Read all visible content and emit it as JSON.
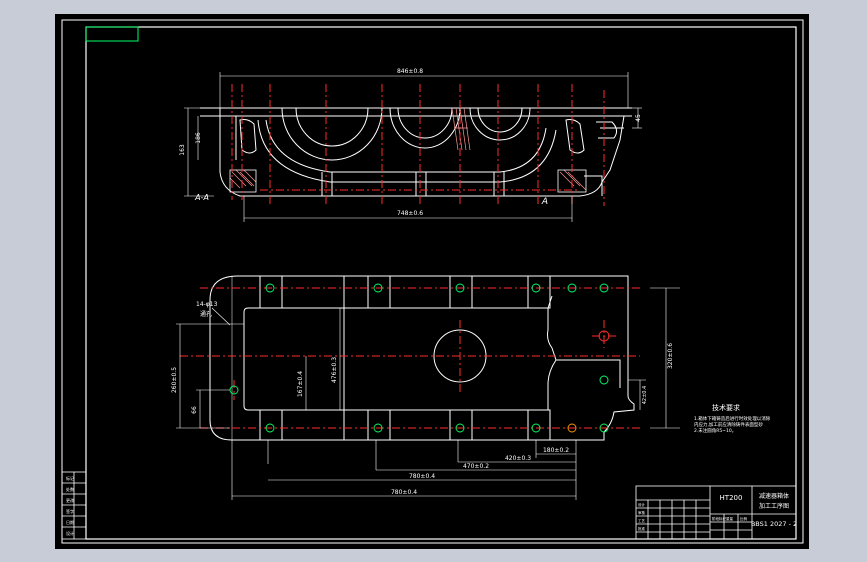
{
  "drawing": {
    "material": "HT200",
    "part_name": "减速器箱体",
    "part_sub": "加工工序图",
    "drawing_no": "BBS1 2027 - 2",
    "label_a_left": "A-A",
    "label_a_right": "A",
    "tech_title": "技术要求",
    "tech_notes": [
      "1.箱体下箱铸造后进行时效处理以消除",
      "  内应力,加工前应清除铸件表面型砂",
      "2.未注圆角R5~10。"
    ],
    "dimensions": {
      "top_length": "846±0.8",
      "top_bottom_length": "748±0.6",
      "left_height": "163",
      "left_inner": "186",
      "right_small": "45",
      "plan_height_right": "320±0.6",
      "plan_left": "260±0.5",
      "plan_left_small": "66",
      "plan_inner": "167±0.4",
      "plan_inner2": "476±0.3",
      "plan_right_small": "42±0.4",
      "bottom_1": "180±0.2",
      "bottom_2": "420±0.3",
      "bottom_3": "470±0.2",
      "bottom_4": "780±0.4",
      "hole_note": "14-φ13",
      "hole_note2": "通孔"
    },
    "left_title_cells": [
      "标记",
      "处数",
      "更改",
      "签字",
      "日期",
      "设计"
    ],
    "title_block_small": [
      "设计",
      "审核",
      "工艺",
      "批准",
      "阶段标记",
      "重量",
      "比例"
    ]
  },
  "colors": {
    "frame": "#ffffff",
    "background": "#000000",
    "centerline": "#ff2a2a",
    "hatch": "#ff9a9a",
    "hole": "#00ff66",
    "tiny_box": "#00ff66"
  }
}
